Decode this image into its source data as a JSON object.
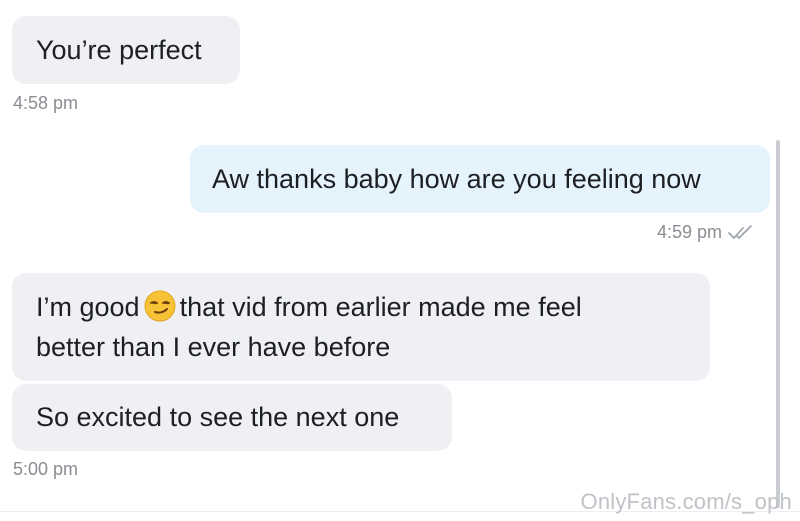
{
  "messages": [
    {
      "direction": "incoming",
      "text": "You’re perfect"
    },
    {
      "direction": "outgoing",
      "text": "Aw thanks baby how are you feeling now"
    },
    {
      "direction": "incoming",
      "text_before_emoji": "I’m good",
      "emoji": "smirking-face",
      "text_after_emoji": "that vid from earlier made me feel",
      "text_line2": "better than I ever have before"
    },
    {
      "direction": "incoming",
      "text": "So excited to see the next one"
    }
  ],
  "timestamps": {
    "first": "4:58 pm",
    "second": "4:59 pm",
    "third": "5:00 pm"
  },
  "read_status_icon": "double-check-icon",
  "watermark": "OnlyFans.com/s_oph",
  "colors": {
    "incoming_bubble": "#eef0f4",
    "outgoing_bubble": "#e5f3fc",
    "text": "#1d1f23",
    "timestamp": "#8a8d93",
    "watermark": "#bfc2c7"
  }
}
